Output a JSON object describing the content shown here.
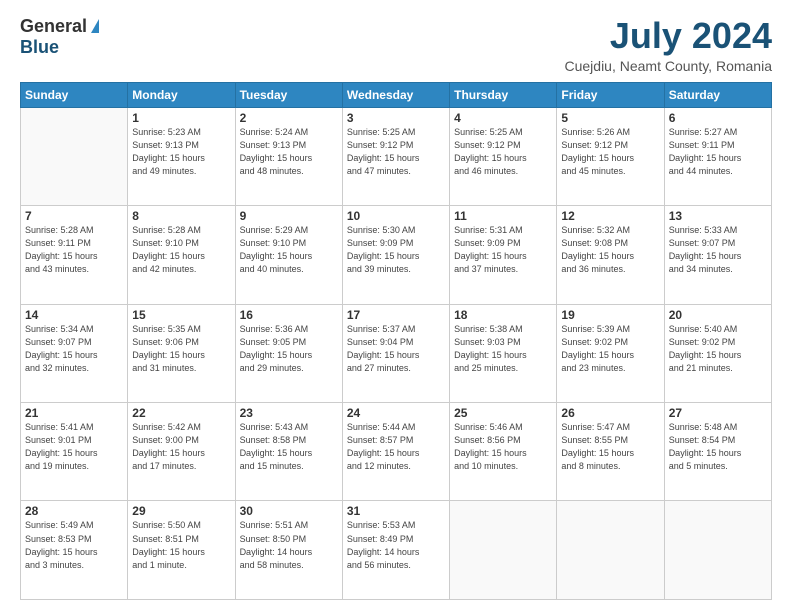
{
  "header": {
    "logo_general": "General",
    "logo_blue": "Blue",
    "month_year": "July 2024",
    "location": "Cuejdiu, Neamt County, Romania"
  },
  "days_of_week": [
    "Sunday",
    "Monday",
    "Tuesday",
    "Wednesday",
    "Thursday",
    "Friday",
    "Saturday"
  ],
  "weeks": [
    [
      {
        "day": "",
        "info": ""
      },
      {
        "day": "1",
        "info": "Sunrise: 5:23 AM\nSunset: 9:13 PM\nDaylight: 15 hours\nand 49 minutes."
      },
      {
        "day": "2",
        "info": "Sunrise: 5:24 AM\nSunset: 9:13 PM\nDaylight: 15 hours\nand 48 minutes."
      },
      {
        "day": "3",
        "info": "Sunrise: 5:25 AM\nSunset: 9:12 PM\nDaylight: 15 hours\nand 47 minutes."
      },
      {
        "day": "4",
        "info": "Sunrise: 5:25 AM\nSunset: 9:12 PM\nDaylight: 15 hours\nand 46 minutes."
      },
      {
        "day": "5",
        "info": "Sunrise: 5:26 AM\nSunset: 9:12 PM\nDaylight: 15 hours\nand 45 minutes."
      },
      {
        "day": "6",
        "info": "Sunrise: 5:27 AM\nSunset: 9:11 PM\nDaylight: 15 hours\nand 44 minutes."
      }
    ],
    [
      {
        "day": "7",
        "info": "Sunrise: 5:28 AM\nSunset: 9:11 PM\nDaylight: 15 hours\nand 43 minutes."
      },
      {
        "day": "8",
        "info": "Sunrise: 5:28 AM\nSunset: 9:10 PM\nDaylight: 15 hours\nand 42 minutes."
      },
      {
        "day": "9",
        "info": "Sunrise: 5:29 AM\nSunset: 9:10 PM\nDaylight: 15 hours\nand 40 minutes."
      },
      {
        "day": "10",
        "info": "Sunrise: 5:30 AM\nSunset: 9:09 PM\nDaylight: 15 hours\nand 39 minutes."
      },
      {
        "day": "11",
        "info": "Sunrise: 5:31 AM\nSunset: 9:09 PM\nDaylight: 15 hours\nand 37 minutes."
      },
      {
        "day": "12",
        "info": "Sunrise: 5:32 AM\nSunset: 9:08 PM\nDaylight: 15 hours\nand 36 minutes."
      },
      {
        "day": "13",
        "info": "Sunrise: 5:33 AM\nSunset: 9:07 PM\nDaylight: 15 hours\nand 34 minutes."
      }
    ],
    [
      {
        "day": "14",
        "info": "Sunrise: 5:34 AM\nSunset: 9:07 PM\nDaylight: 15 hours\nand 32 minutes."
      },
      {
        "day": "15",
        "info": "Sunrise: 5:35 AM\nSunset: 9:06 PM\nDaylight: 15 hours\nand 31 minutes."
      },
      {
        "day": "16",
        "info": "Sunrise: 5:36 AM\nSunset: 9:05 PM\nDaylight: 15 hours\nand 29 minutes."
      },
      {
        "day": "17",
        "info": "Sunrise: 5:37 AM\nSunset: 9:04 PM\nDaylight: 15 hours\nand 27 minutes."
      },
      {
        "day": "18",
        "info": "Sunrise: 5:38 AM\nSunset: 9:03 PM\nDaylight: 15 hours\nand 25 minutes."
      },
      {
        "day": "19",
        "info": "Sunrise: 5:39 AM\nSunset: 9:02 PM\nDaylight: 15 hours\nand 23 minutes."
      },
      {
        "day": "20",
        "info": "Sunrise: 5:40 AM\nSunset: 9:02 PM\nDaylight: 15 hours\nand 21 minutes."
      }
    ],
    [
      {
        "day": "21",
        "info": "Sunrise: 5:41 AM\nSunset: 9:01 PM\nDaylight: 15 hours\nand 19 minutes."
      },
      {
        "day": "22",
        "info": "Sunrise: 5:42 AM\nSunset: 9:00 PM\nDaylight: 15 hours\nand 17 minutes."
      },
      {
        "day": "23",
        "info": "Sunrise: 5:43 AM\nSunset: 8:58 PM\nDaylight: 15 hours\nand 15 minutes."
      },
      {
        "day": "24",
        "info": "Sunrise: 5:44 AM\nSunset: 8:57 PM\nDaylight: 15 hours\nand 12 minutes."
      },
      {
        "day": "25",
        "info": "Sunrise: 5:46 AM\nSunset: 8:56 PM\nDaylight: 15 hours\nand 10 minutes."
      },
      {
        "day": "26",
        "info": "Sunrise: 5:47 AM\nSunset: 8:55 PM\nDaylight: 15 hours\nand 8 minutes."
      },
      {
        "day": "27",
        "info": "Sunrise: 5:48 AM\nSunset: 8:54 PM\nDaylight: 15 hours\nand 5 minutes."
      }
    ],
    [
      {
        "day": "28",
        "info": "Sunrise: 5:49 AM\nSunset: 8:53 PM\nDaylight: 15 hours\nand 3 minutes."
      },
      {
        "day": "29",
        "info": "Sunrise: 5:50 AM\nSunset: 8:51 PM\nDaylight: 15 hours\nand 1 minute."
      },
      {
        "day": "30",
        "info": "Sunrise: 5:51 AM\nSunset: 8:50 PM\nDaylight: 14 hours\nand 58 minutes."
      },
      {
        "day": "31",
        "info": "Sunrise: 5:53 AM\nSunset: 8:49 PM\nDaylight: 14 hours\nand 56 minutes."
      },
      {
        "day": "",
        "info": ""
      },
      {
        "day": "",
        "info": ""
      },
      {
        "day": "",
        "info": ""
      }
    ]
  ]
}
